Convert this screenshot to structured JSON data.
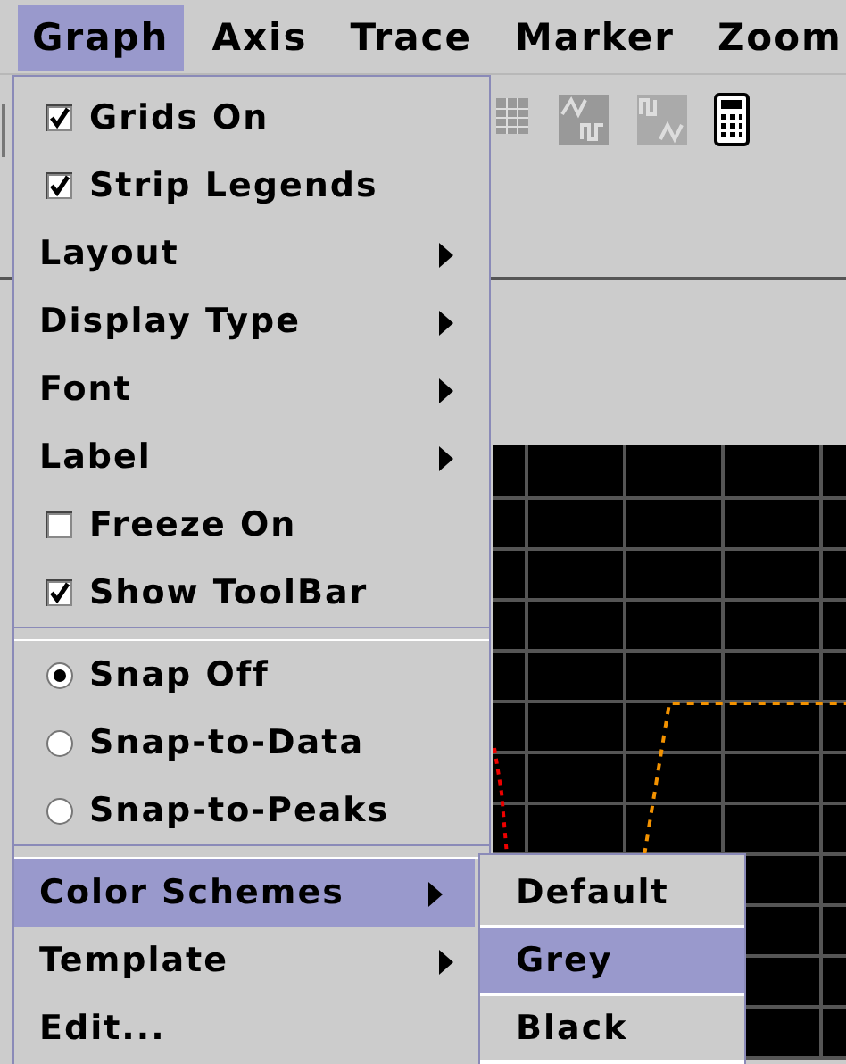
{
  "menubar": [
    {
      "label": "Graph",
      "selected": true
    },
    {
      "label": "Axis",
      "selected": false
    },
    {
      "label": "Trace",
      "selected": false
    },
    {
      "label": "Marker",
      "selected": false
    },
    {
      "label": "Zoom",
      "selected": false
    }
  ],
  "menu": {
    "items": [
      {
        "kind": "check",
        "label": "Grids On",
        "checked": true
      },
      {
        "kind": "check",
        "label": "Strip Legends",
        "checked": true
      },
      {
        "kind": "submenu",
        "label": "Layout",
        "expanded": false
      },
      {
        "kind": "submenu",
        "label": "Display Type",
        "expanded": false
      },
      {
        "kind": "submenu",
        "label": "Font",
        "expanded": false
      },
      {
        "kind": "submenu",
        "label": "Label",
        "expanded": false
      },
      {
        "kind": "check",
        "label": "Freeze On",
        "checked": false
      },
      {
        "kind": "check",
        "label": "Show ToolBar",
        "checked": true
      },
      {
        "kind": "separator"
      },
      {
        "kind": "radio",
        "label": "Snap Off",
        "selected": true
      },
      {
        "kind": "radio",
        "label": "Snap-to-Data",
        "selected": false
      },
      {
        "kind": "radio",
        "label": "Snap-to-Peaks",
        "selected": false
      },
      {
        "kind": "separator"
      },
      {
        "kind": "submenu",
        "label": "Color Schemes",
        "expanded": true
      },
      {
        "kind": "submenu",
        "label": "Template",
        "expanded": false
      },
      {
        "kind": "plain",
        "label": "Edit..."
      }
    ]
  },
  "submenu": {
    "items": [
      {
        "label": "Default",
        "selected": false
      },
      {
        "label": "Grey",
        "selected": true
      },
      {
        "label": "Black",
        "selected": false
      }
    ]
  }
}
